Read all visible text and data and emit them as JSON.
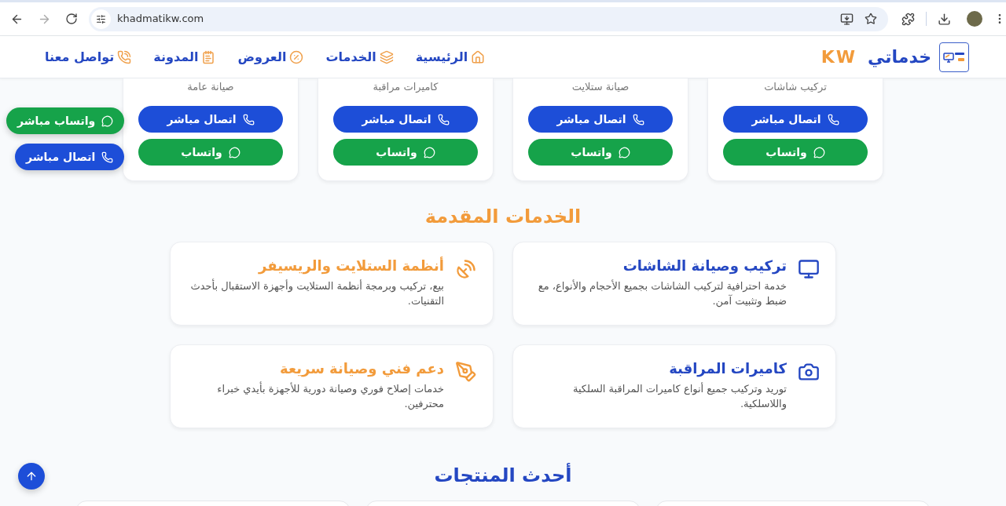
{
  "browser": {
    "url": "khadmatikw.com"
  },
  "header": {
    "brand": {
      "name": "خدماتي",
      "suffix": "KW"
    },
    "nav": [
      {
        "label": "الرئيسية"
      },
      {
        "label": "الخدمات"
      },
      {
        "label": "العروض"
      },
      {
        "label": "المدونة"
      },
      {
        "label": "تواصل معنا"
      }
    ]
  },
  "quick_cards": [
    {
      "subtitle": "تركيب شاشات",
      "call_label": "اتصال مباشر",
      "whatsapp_label": "واتساب"
    },
    {
      "subtitle": "صيانة ستلايت",
      "call_label": "اتصال مباشر",
      "whatsapp_label": "واتساب"
    },
    {
      "subtitle": "كاميرات مراقبة",
      "call_label": "اتصال مباشر",
      "whatsapp_label": "واتساب"
    },
    {
      "subtitle": "صيانة عامة",
      "call_label": "اتصال مباشر",
      "whatsapp_label": "واتساب"
    }
  ],
  "floating_buttons": [
    {
      "label": "واتساب مباشر",
      "kind": "whatsapp"
    },
    {
      "label": "اتصال مباشر",
      "kind": "call"
    }
  ],
  "services": {
    "title": "الخدمات المقدمة",
    "items": [
      {
        "title": "تركيب وصيانة الشاشات",
        "description": "خدمة احترافية لتركيب الشاشات بجميع الأحجام والأنواع، مع ضبط وتثبيت آمن.",
        "color": "#2447c2"
      },
      {
        "title": "أنظمة الستلايت والريسيفر",
        "description": "بيع، تركيب وبرمجة أنظمة الستلايت وأجهزة الاستقبال بأحدث التقنيات.",
        "color": "#f29b3b"
      },
      {
        "title": "كاميرات المراقبة",
        "description": "توريد وتركيب جميع أنواع كاميرات المراقبة السلكية واللاسلكية.",
        "color": "#2447c2"
      },
      {
        "title": "دعم فني وصيانة سريعة",
        "description": "خدمات إصلاح فوري وصيانة دورية للأجهزة بأيدي خبراء محترفين.",
        "color": "#f29b3b"
      }
    ]
  },
  "products": {
    "title": "أحدث المنتجات"
  }
}
